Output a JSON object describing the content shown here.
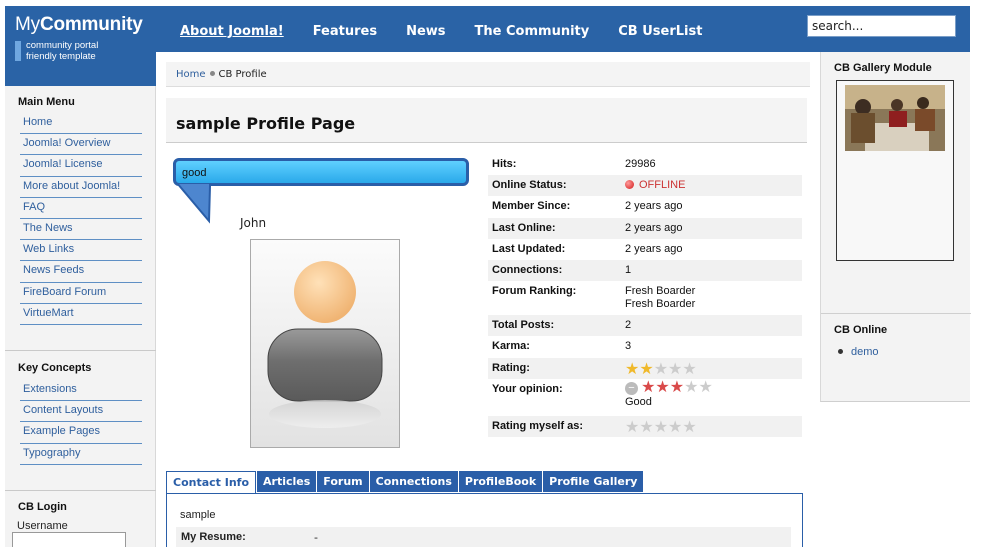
{
  "brand": {
    "title_prefix": "My",
    "title_bold": "Community",
    "tagline_line1": "community portal",
    "tagline_line2": "friendly template"
  },
  "nav": {
    "items": [
      "About Joomla!",
      "Features",
      "News",
      "The Community",
      "CB UserList"
    ],
    "active": "About Joomla!"
  },
  "search": {
    "value": "search..."
  },
  "sidebar": {
    "main_menu_title": "Main Menu",
    "main_menu": [
      "Home",
      "Joomla! Overview",
      "Joomla! License",
      "More about Joomla!",
      "FAQ",
      "The News",
      "Web Links",
      "News Feeds",
      "FireBoard Forum",
      "VirtueMart"
    ],
    "key_concepts_title": "Key Concepts",
    "key_concepts": [
      "Extensions",
      "Content Layouts",
      "Example Pages",
      "Typography"
    ],
    "login_title": "CB Login",
    "username_label": "Username"
  },
  "breadcrumb": {
    "home": "Home",
    "current": "CB Profile"
  },
  "page": {
    "title": "sample Profile Page"
  },
  "profile": {
    "status_message": "good",
    "name": "John",
    "stats": [
      {
        "label": "Hits:",
        "value": "29986"
      },
      {
        "label": "Online Status:",
        "value": "OFFLINE"
      },
      {
        "label": "Member Since:",
        "value": "2 years ago"
      },
      {
        "label": "Last Online:",
        "value": "2 years ago"
      },
      {
        "label": "Last Updated:",
        "value": "2 years ago"
      },
      {
        "label": "Connections:",
        "value": "1"
      },
      {
        "label": "Forum Ranking:",
        "value": "Fresh Boarder",
        "value2": "Fresh Boarder"
      },
      {
        "label": "Total Posts:",
        "value": "2"
      },
      {
        "label": "Karma:",
        "value": "3"
      },
      {
        "label": "Rating:",
        "stars_filled": 2,
        "stars_total": 5
      },
      {
        "label": "Your opinion:",
        "stars_filled": 3,
        "stars_total": 5,
        "caption": "Good"
      },
      {
        "label": "Rating myself as:",
        "stars_filled": 0,
        "stars_total": 5
      }
    ]
  },
  "tabs": {
    "items": [
      "Contact Info",
      "Articles",
      "Forum",
      "Connections",
      "ProfileBook",
      "Profile Gallery"
    ],
    "active": "Contact Info",
    "panel_text": "sample",
    "panel_row_label": "My Resume:",
    "panel_row_value": "-"
  },
  "right": {
    "gallery_title": "CB Gallery Module",
    "online_title": "CB Online",
    "online_users": [
      "demo"
    ]
  },
  "colors": {
    "brand_blue": "#2a63a6",
    "link": "#2f5f9d",
    "offline": "#cc3333",
    "star_gold": "#f0b92b",
    "star_red": "#d94a4a",
    "star_empty": "#cccccc"
  }
}
